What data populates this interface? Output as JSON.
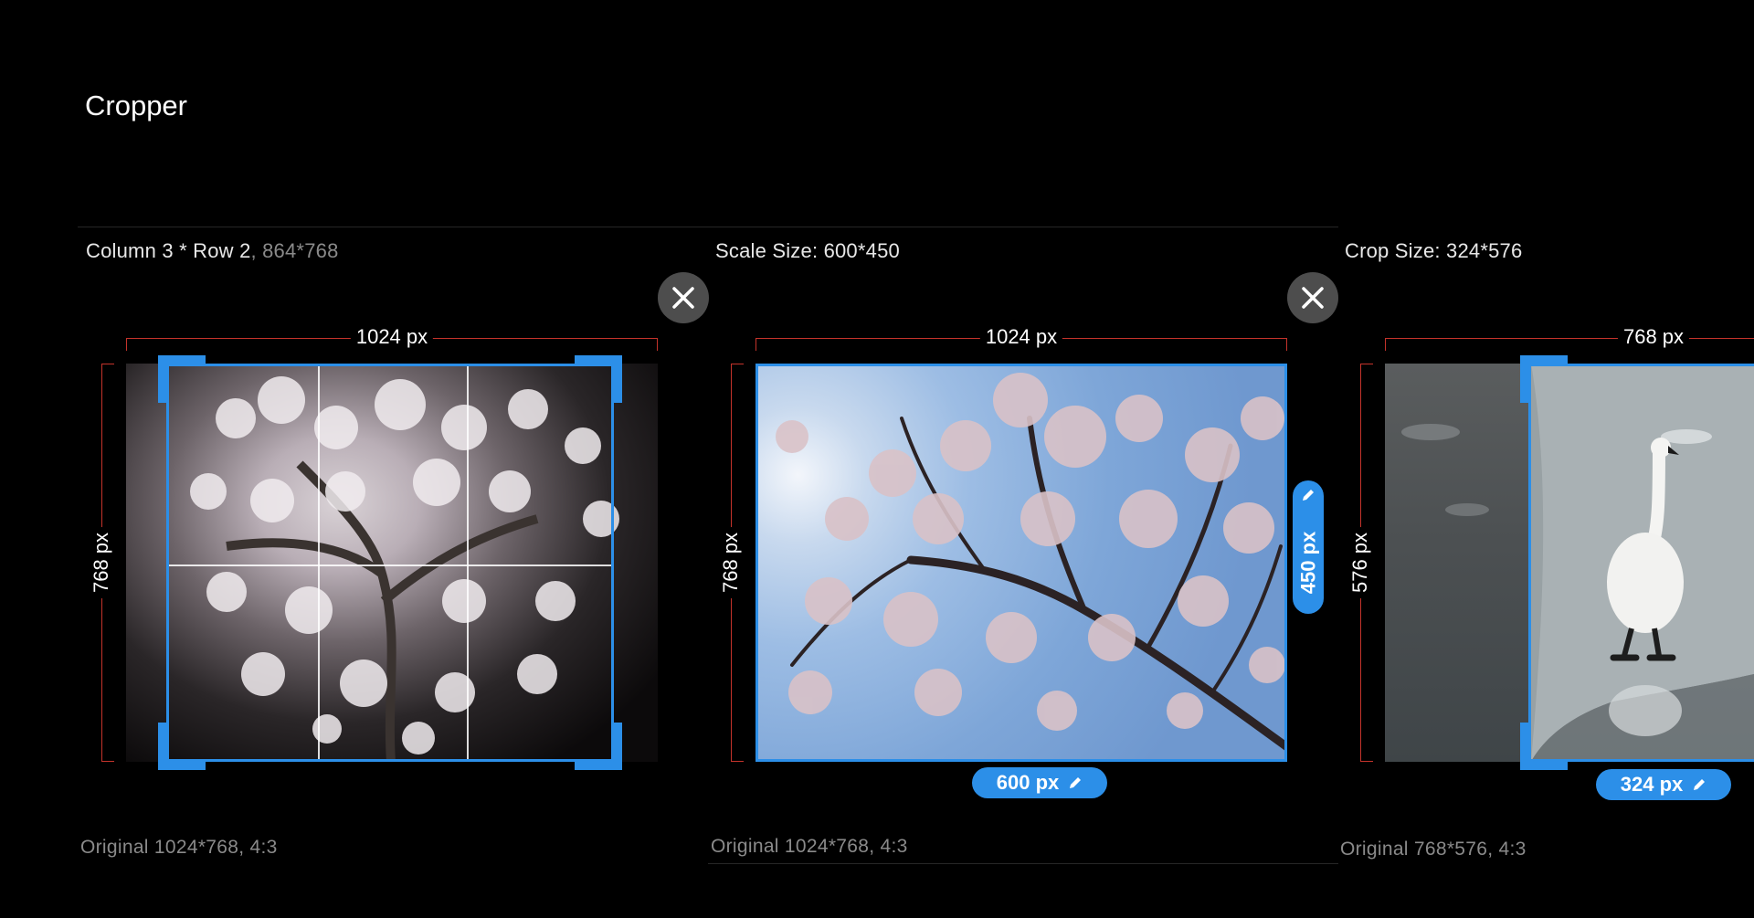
{
  "app": {
    "title": "Cropper"
  },
  "panels": [
    {
      "caption_main": "Column 3 * Row 2",
      "caption_sep": ", ",
      "caption_sub": "864*768",
      "width_label": "1024 px",
      "height_label": "768 px",
      "original": "Original 1024*768, 4:3"
    },
    {
      "caption_main": "Scale Size: 600*450",
      "width_label": "1024 px",
      "height_label": "768 px",
      "pill_width": "600 px",
      "pill_height": "450 px",
      "original": "Original 1024*768, 4:3"
    },
    {
      "caption_main": "Crop Size: 324*576",
      "width_label": "768 px",
      "height_label": "576 px",
      "pill_width": "324 px",
      "original": "Original 768*576, 4:3"
    }
  ],
  "icons": {
    "close": "close-icon",
    "edit": "pencil-icon"
  },
  "colors": {
    "accent": "#2c8fe8",
    "dimension_line": "#c4332b",
    "close_bg": "#4d4d4d"
  }
}
